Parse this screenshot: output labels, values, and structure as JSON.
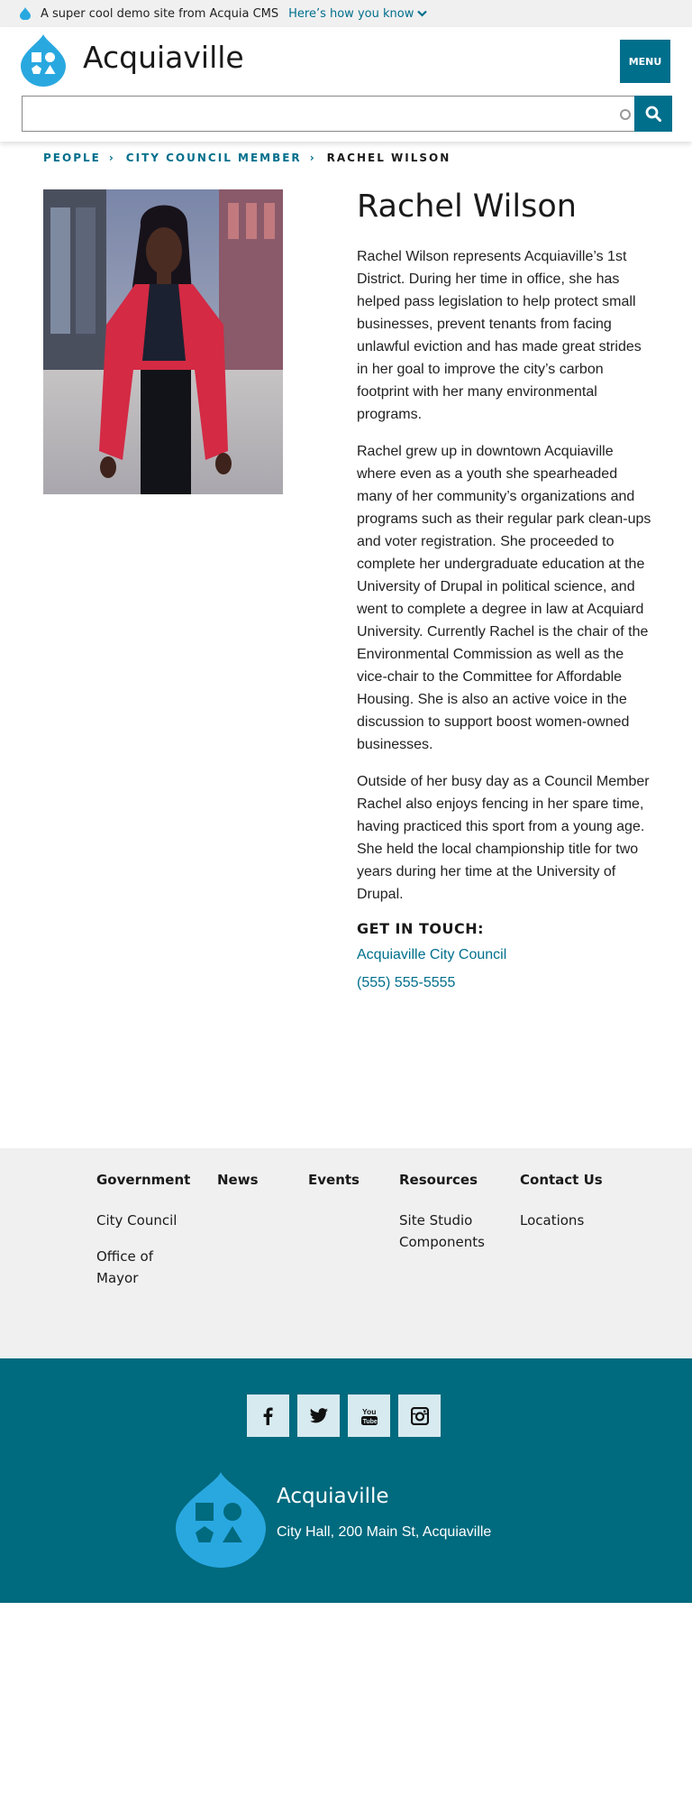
{
  "banner": {
    "text": "A super cool demo site from Acquia CMS",
    "link_label": "Here’s how you know"
  },
  "header": {
    "site_name": "Acquiaville",
    "menu_label": "MENU",
    "search_placeholder": ""
  },
  "breadcrumb": {
    "items": [
      "PEOPLE",
      "CITY COUNCIL MEMBER"
    ],
    "current": "RACHEL WILSON"
  },
  "person": {
    "name": "Rachel Wilson",
    "bio": [
      "Rachel Wilson represents Acquiaville’s 1st District. During her time in office, she has helped pass legislation to help protect small businesses, prevent tenants from facing unlawful eviction and has made great strides in her goal to improve the city’s carbon footprint with her many environmental programs.",
      "Rachel grew up in downtown Acquiaville where even as a youth she spearheaded many of her community’s organizations and programs such as their regular park clean-ups and voter registration. She proceeded to complete her undergraduate education at the University of Drupal in political science, and went to complete a degree in law at Acquiard University. Currently Rachel is the chair of the Environmental Commission as well as the vice-chair to the Committee for Affordable Housing. She is also an active voice in the discussion to support boost women-owned businesses.",
      "Outside of her busy day as a Council Member Rachel also enjoys fencing in her spare time, having practiced this sport from a young age. She held the local championship title for two years during her time at the University of Drupal."
    ],
    "contact_heading": "GET IN TOUCH:",
    "organization": "Acquiaville City Council",
    "phone": "(555) 555-5555"
  },
  "footer_nav": {
    "columns": [
      {
        "heading": "Government",
        "items": [
          "City Council",
          "Office of Mayor"
        ]
      },
      {
        "heading": "News",
        "items": []
      },
      {
        "heading": "Events",
        "items": []
      },
      {
        "heading": "Resources",
        "items": [
          "Site Studio Components"
        ]
      },
      {
        "heading": "Contact Us",
        "items": [
          "Locations"
        ]
      }
    ]
  },
  "footer": {
    "social_icons": [
      "facebook-icon",
      "twitter-icon",
      "youtube-icon",
      "instagram-icon"
    ],
    "site_name": "Acquiaville",
    "address": "City Hall, 200 Main St, Acquiaville"
  },
  "colors": {
    "brand_teal": "#006f8c",
    "logo_blue": "#29a8e0",
    "footer_bg": "#006a7e",
    "light_gray": "#f0f0f0"
  }
}
